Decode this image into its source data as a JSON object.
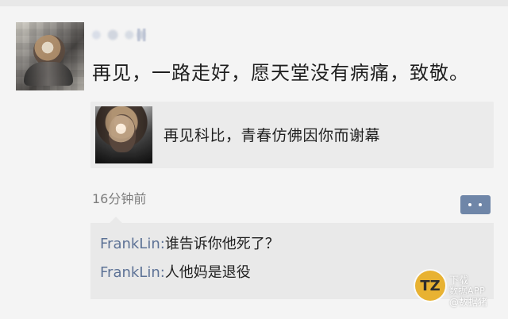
{
  "post": {
    "text": "再见，一路走好，愿天堂没有病痛，致敬。"
  },
  "share_card": {
    "title": "再见科比，青春仿佛因你而谢幕"
  },
  "meta": {
    "timestamp": "16分钟前"
  },
  "comments": [
    {
      "name": "FrankLin:",
      "text": "谁告诉你他死了？"
    },
    {
      "name": "FrankLin:",
      "text": "人他妈是退役"
    }
  ],
  "branding": {
    "logo_text": "TZ",
    "watermark_line_1": "下载",
    "watermark_line_2": "数据APP",
    "watermark_line_3": "@数据猪"
  }
}
